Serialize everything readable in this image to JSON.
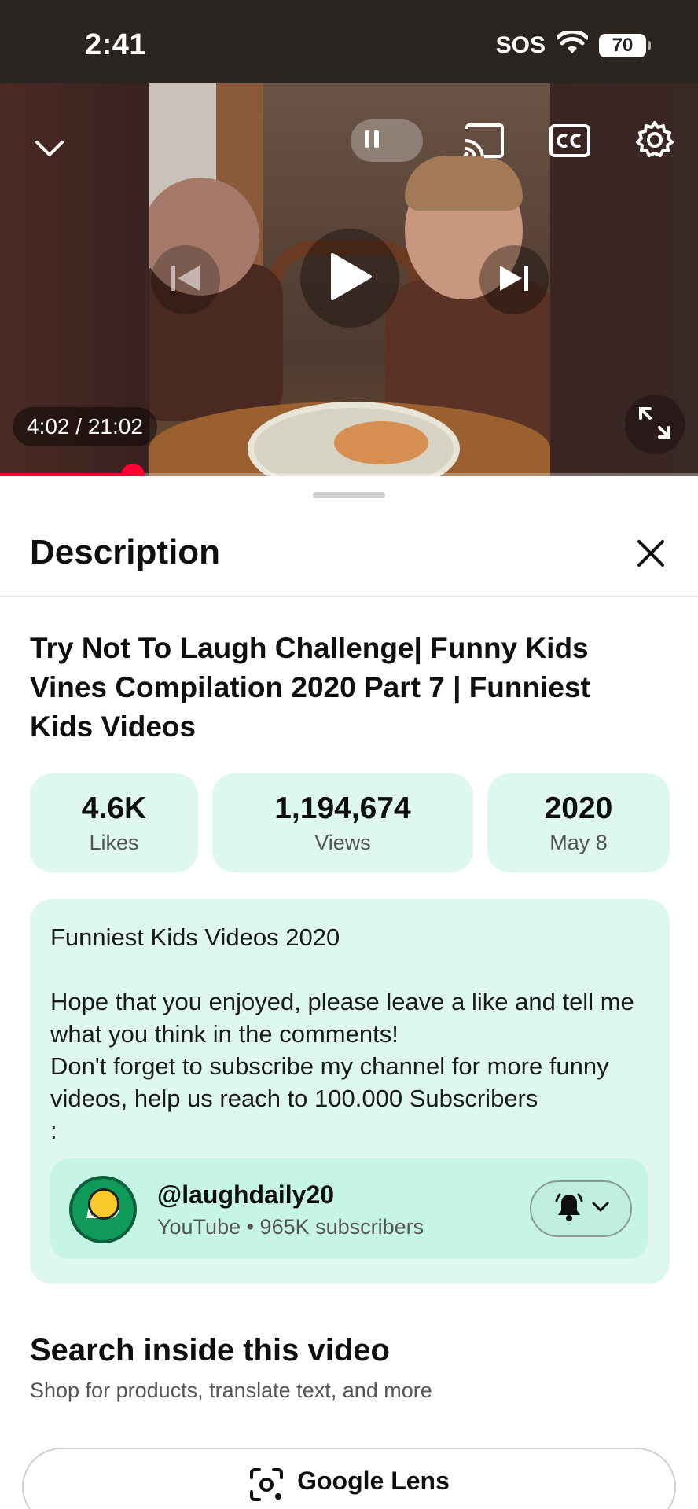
{
  "status_bar": {
    "time": "2:41",
    "sos": "SOS",
    "battery": "70"
  },
  "player": {
    "time_display": "4:02 / 21:02",
    "progress_fraction": 0.19,
    "icons": [
      "chevron-down-icon",
      "pause-icon",
      "cast-icon",
      "closed-captions-icon",
      "settings-icon",
      "previous-icon",
      "play-icon",
      "next-icon",
      "fullscreen-icon"
    ]
  },
  "description": {
    "header": "Description",
    "title": "Try Not To Laugh Challenge| Funny Kids Vines Compilation 2020 Part 7 | Funniest Kids Videos",
    "stats": {
      "likes_value": "4.6K",
      "likes_label": "Likes",
      "views_value": "1,194,674",
      "views_label": "Views",
      "year": "2020",
      "date": "May 8"
    },
    "text": "Funniest Kids Videos 2020\n\nHope that you enjoyed, please leave a like and tell me what you think in the comments!\nDon't forget to subscribe my channel for more funny videos, help us reach to 100.000 Subscribers\n:",
    "channel": {
      "avatar_text": "LD",
      "handle": "@laughdaily20",
      "meta": "YouTube • 965K subscribers"
    }
  },
  "search_section": {
    "title": "Search inside this video",
    "subtitle": "Shop for products, translate text, and more",
    "lens_label": "Google Lens"
  },
  "colors": {
    "accent": "#ff0033",
    "card_bg": "#def8f0",
    "channel_bg": "#c6f5e6"
  }
}
